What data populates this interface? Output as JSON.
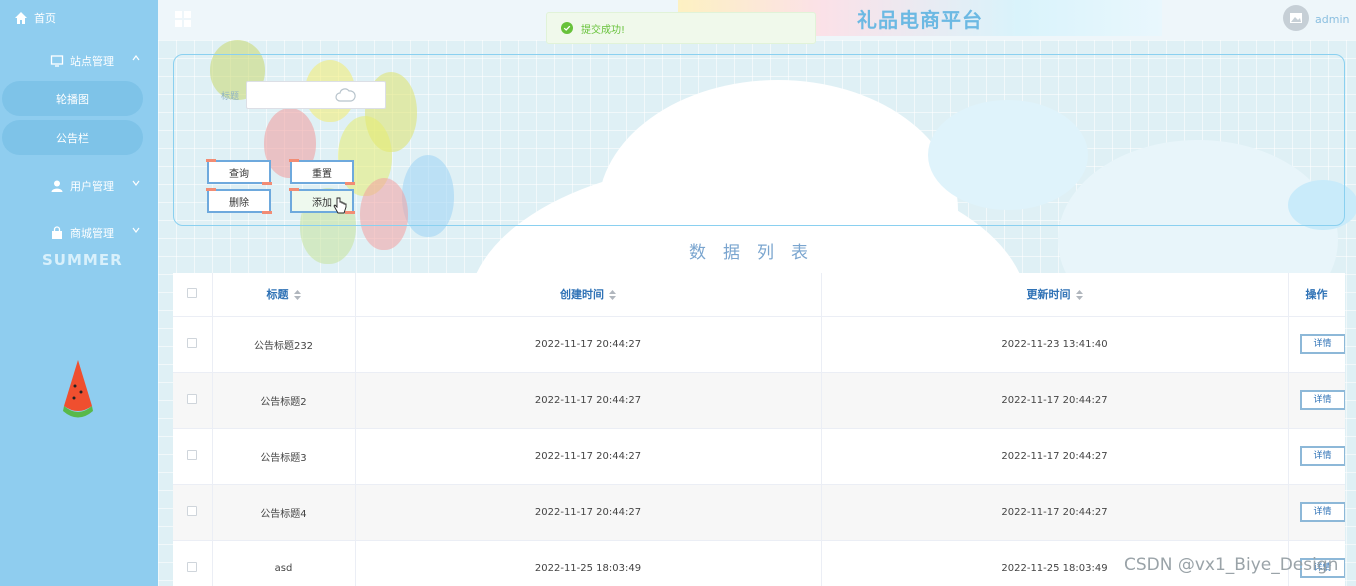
{
  "sidebar": {
    "home": "首页",
    "site_mgmt": "站点管理",
    "sub_items": [
      "轮播图",
      "公告栏"
    ],
    "user_mgmt": "用户管理",
    "mall_mgmt": "商城管理",
    "summer_text": "SUMMER"
  },
  "header": {
    "title": "礼品电商平台",
    "username": "admin"
  },
  "toast": {
    "message": "提交成功!"
  },
  "search": {
    "title_label": "标题",
    "title_value": "",
    "buttons": {
      "query": "查询",
      "reset": "重置",
      "delete": "删除",
      "add": "添加"
    }
  },
  "list_heading": "数据列表",
  "table": {
    "columns": [
      "标题",
      "创建时间",
      "更新时间",
      "操作"
    ],
    "rows": [
      {
        "title": "公告标题232",
        "created": "2022-11-17 20:44:27",
        "updated": "2022-11-23 13:41:40",
        "action": "详情"
      },
      {
        "title": "公告标题2",
        "created": "2022-11-17 20:44:27",
        "updated": "2022-11-17 20:44:27",
        "action": "详情"
      },
      {
        "title": "公告标题3",
        "created": "2022-11-17 20:44:27",
        "updated": "2022-11-17 20:44:27",
        "action": "详情"
      },
      {
        "title": "公告标题4",
        "created": "2022-11-17 20:44:27",
        "updated": "2022-11-17 20:44:27",
        "action": "详情"
      },
      {
        "title": "asd",
        "created": "2022-11-25 18:03:49",
        "updated": "2022-11-25 18:03:49",
        "action": "详情"
      }
    ]
  },
  "watermark": "CSDN @vx1_Biye_Design",
  "colors": {
    "sidebar": "#8fcdef",
    "accent": "#2f72b6",
    "success": "#67c23a"
  }
}
